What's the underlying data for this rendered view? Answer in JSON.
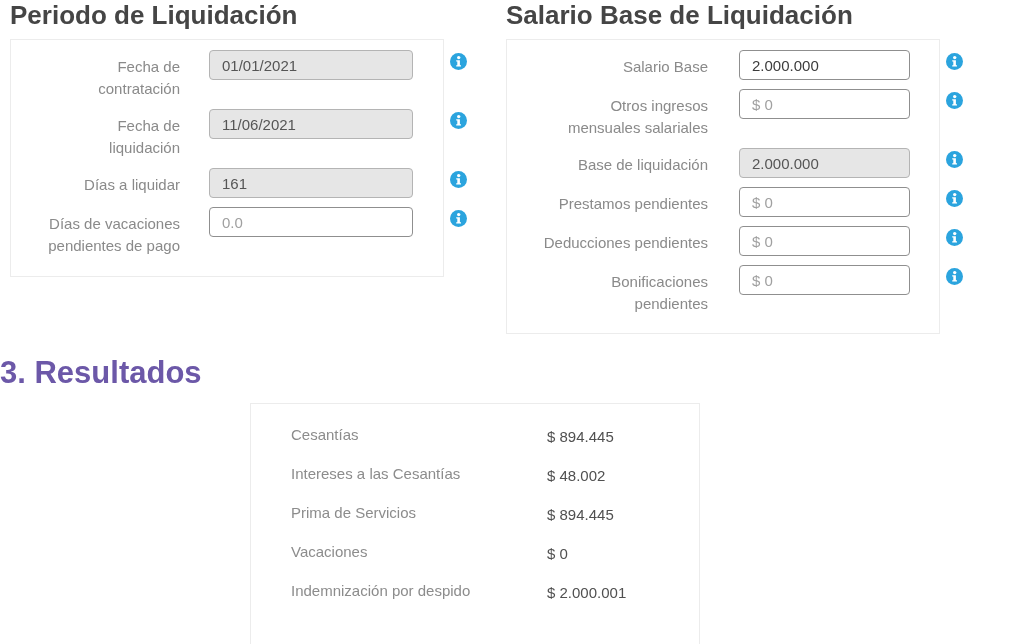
{
  "periodo": {
    "title": "Periodo de Liquidación",
    "fields": [
      {
        "label": "Fecha de contratación",
        "value": "01/01/2021",
        "disabled": true
      },
      {
        "label": "Fecha de liquidación",
        "value": "11/06/2021",
        "disabled": true
      },
      {
        "label": "Días a liquidar",
        "value": "161",
        "disabled": true
      },
      {
        "label": "Días de vacaciones pendientes de pago",
        "placeholder": "0.0",
        "disabled": false
      }
    ]
  },
  "salario": {
    "title": "Salario Base de Liquidación",
    "fields": [
      {
        "label": "Salario Base",
        "value": "2.000.000",
        "disabled": false
      },
      {
        "label": "Otros ingresos mensuales salariales",
        "placeholder": "$ 0",
        "disabled": false
      },
      {
        "label": "Base de liquidación",
        "value": "2.000.000",
        "disabled": true
      },
      {
        "label": "Prestamos pendientes",
        "placeholder": "$ 0",
        "disabled": false
      },
      {
        "label": "Deducciones pendientes",
        "placeholder": "$ 0",
        "disabled": false
      },
      {
        "label": "Bonificaciones pendientes",
        "placeholder": "$ 0",
        "disabled": false
      }
    ]
  },
  "resultados": {
    "title": "3. Resultados",
    "rows": [
      {
        "label": "Cesantías",
        "amount": "$ 894.445"
      },
      {
        "label": "Intereses a las Cesantías",
        "amount": "$ 48.002"
      },
      {
        "label": "Prima de Servicios",
        "amount": "$ 894.445"
      },
      {
        "label": "Vacaciones",
        "amount": "$ 0"
      },
      {
        "label": "Indemnización por despido",
        "amount": "$ 2.000.001"
      }
    ]
  }
}
